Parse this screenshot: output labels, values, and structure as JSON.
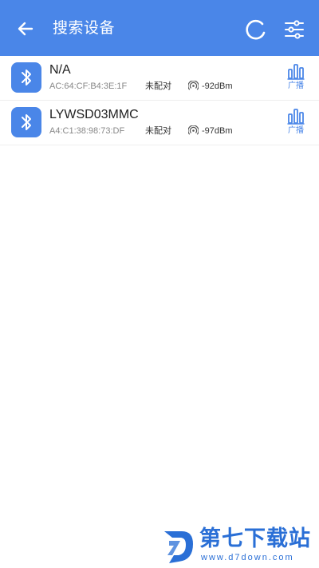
{
  "header": {
    "title": "搜索设备",
    "back_icon": "arrow-left-icon",
    "refresh_icon": "refresh-icon",
    "filter_icon": "sliders-icon"
  },
  "colors": {
    "primary": "#4a86e8",
    "watermark": "#2a6fd6"
  },
  "devices": [
    {
      "name": "N/A",
      "mac": "AC:64:CF:B4:3E:1F",
      "pair_status": "未配对",
      "rssi": "-92dBm",
      "action_label": "广播"
    },
    {
      "name": "LYWSD03MMC",
      "mac": "A4:C1:38:98:73:DF",
      "pair_status": "未配对",
      "rssi": "-97dBm",
      "action_label": "广播"
    }
  ],
  "watermark": {
    "title": "第七下载站",
    "url": "www.d7down.com"
  }
}
